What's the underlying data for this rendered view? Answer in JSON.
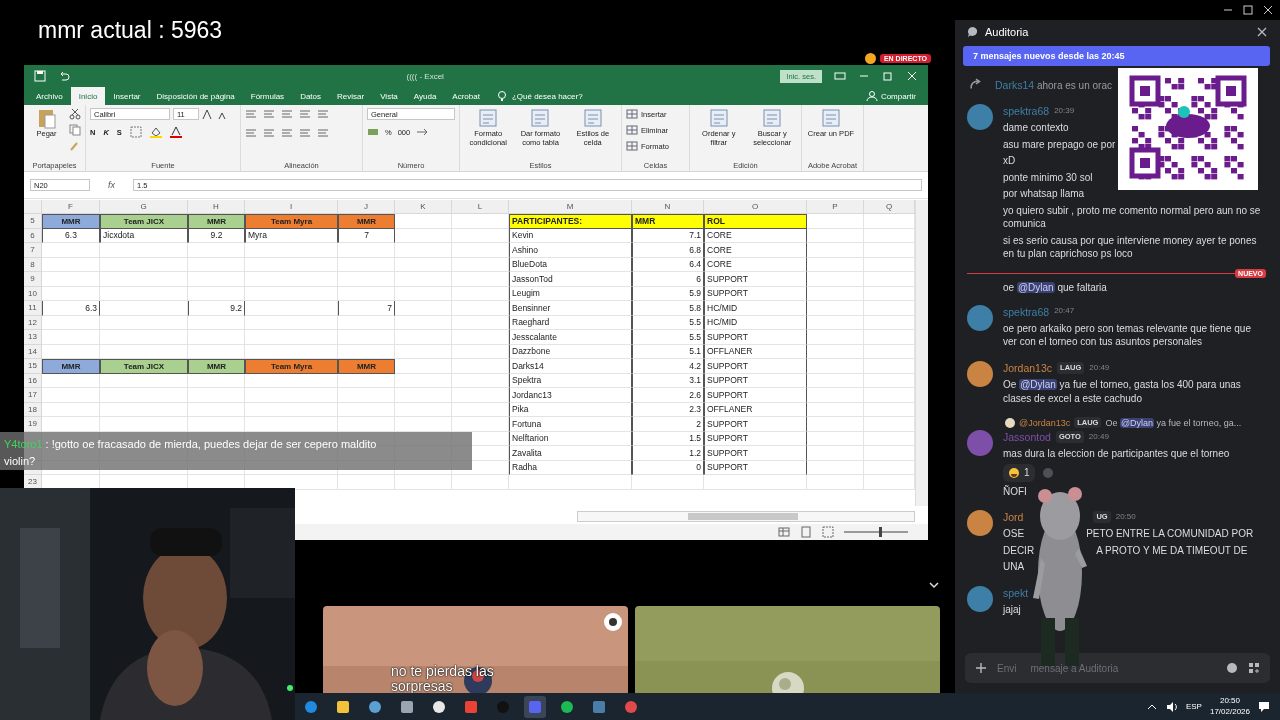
{
  "stream_title": "mmr actual : 5963",
  "live_badge": "EN DIRECTO",
  "excel": {
    "title": "(((( - Excel",
    "sign_in": "Inic. ses.",
    "tabs": [
      {
        "label": "Archivo",
        "selected": false
      },
      {
        "label": "Inicio",
        "selected": true
      },
      {
        "label": "Insertar",
        "selected": false
      },
      {
        "label": "Disposición de página",
        "selected": false
      },
      {
        "label": "Fórmulas",
        "selected": false
      },
      {
        "label": "Datos",
        "selected": false
      },
      {
        "label": "Revisar",
        "selected": false
      },
      {
        "label": "Vista",
        "selected": false
      },
      {
        "label": "Ayuda",
        "selected": false
      },
      {
        "label": "Acrobat",
        "selected": false
      }
    ],
    "tell_me": "¿Qué desea hacer?",
    "share": "Compartir",
    "ribbon": [
      {
        "kind": "clipboard",
        "label": "Portapapeles",
        "buttons": [
          "Pegar"
        ]
      },
      {
        "kind": "font",
        "label": "Fuente",
        "font": "Calibri",
        "size": "11",
        "styles": [
          "N",
          "K",
          "S"
        ]
      },
      {
        "kind": "alignment",
        "label": "Alineación"
      },
      {
        "kind": "number",
        "label": "Número",
        "format": "General",
        "symbols": [
          "%",
          "000"
        ]
      },
      {
        "kind": "big-buttons",
        "label": "Estilos",
        "buttons": [
          "Formato condicional",
          "Dar formato como tabla",
          "Estilos de celda"
        ]
      },
      {
        "kind": "small-buttons",
        "label": "Celdas",
        "buttons": [
          "Insertar",
          "Eliminar",
          "Formato"
        ]
      },
      {
        "kind": "big-buttons",
        "label": "Edición",
        "buttons": [
          "Ordenar y filtrar",
          "Buscar y seleccionar"
        ]
      },
      {
        "kind": "big-buttons",
        "label": "Adobe Acrobat",
        "buttons": [
          "Crear un PDF"
        ]
      }
    ],
    "name_box": "N20",
    "fx": "fx",
    "formula": "1.5",
    "columns": [
      "F",
      "G",
      "H",
      "I",
      "J",
      "K",
      "L",
      "M",
      "N",
      "O",
      "P",
      "Q"
    ],
    "rows": [
      {
        "number": "5",
        "cells": [
          {
            "kind": "team-header",
            "text": "MMR",
            "color": "#8eaadb"
          },
          {
            "kind": "team-header",
            "text": "Team JICX",
            "color": "#a9d08e"
          },
          {
            "kind": "team-header",
            "text": "MMR",
            "color": "#a9d08e"
          },
          {
            "kind": "team-header",
            "text": "Team Myra",
            "color": "#ed7d31"
          },
          {
            "kind": "team-header",
            "text": "MMR",
            "color": "#ed7d31"
          },
          null,
          null,
          {
            "kind": "list-header",
            "text": "PARTICIPANTES:",
            "color": "#ffff00"
          },
          {
            "kind": "list-header",
            "text": "MMR",
            "color": "#ffff00"
          },
          {
            "kind": "list-header",
            "text": "ROL",
            "color": "#ffff00"
          }
        ]
      },
      {
        "number": "6",
        "cells": [
          {
            "kind": "value",
            "text": "6.3"
          },
          {
            "kind": "label",
            "text": "Jicxdota"
          },
          {
            "kind": "value",
            "text": "9.2"
          },
          {
            "kind": "label",
            "text": "Myra"
          },
          {
            "kind": "value",
            "text": "7"
          },
          null,
          null,
          {
            "kind": "label",
            "text": "Kevin"
          },
          {
            "kind": "number",
            "text": "7.1"
          },
          {
            "kind": "label",
            "text": "CORE"
          }
        ]
      },
      {
        "number": "7",
        "cells": [
          null,
          null,
          null,
          null,
          null,
          null,
          null,
          {
            "kind": "label",
            "text": "Ashino"
          },
          {
            "kind": "number",
            "text": "6.8"
          },
          {
            "kind": "label",
            "text": "CORE"
          }
        ]
      },
      {
        "number": "8",
        "cells": [
          null,
          null,
          null,
          null,
          null,
          null,
          null,
          {
            "kind": "label",
            "text": "BlueDota"
          },
          {
            "kind": "number",
            "text": "6.4"
          },
          {
            "kind": "label",
            "text": "CORE"
          }
        ]
      },
      {
        "number": "9",
        "cells": [
          null,
          null,
          null,
          null,
          null,
          null,
          null,
          {
            "kind": "label",
            "text": "JassonTod"
          },
          {
            "kind": "number",
            "text": "6"
          },
          {
            "kind": "label",
            "text": "SUPPORT"
          }
        ]
      },
      {
        "number": "10",
        "cells": [
          null,
          null,
          null,
          null,
          null,
          null,
          null,
          {
            "kind": "label",
            "text": "Leugim"
          },
          {
            "kind": "number",
            "text": "5.9"
          },
          {
            "kind": "label",
            "text": "SUPPORT"
          }
        ]
      },
      {
        "number": "11",
        "cells": [
          {
            "kind": "number",
            "text": "6.3"
          },
          null,
          {
            "kind": "number",
            "text": "9.2"
          },
          null,
          {
            "kind": "number",
            "text": "7"
          },
          null,
          null,
          {
            "kind": "label",
            "text": "Bensinner"
          },
          {
            "kind": "number",
            "text": "5.8"
          },
          {
            "kind": "label",
            "text": "HC/MID"
          }
        ]
      },
      {
        "number": "12",
        "cells": [
          null,
          null,
          null,
          null,
          null,
          null,
          null,
          {
            "kind": "label",
            "text": "Raeghard"
          },
          {
            "kind": "number",
            "text": "5.5"
          },
          {
            "kind": "label",
            "text": "HC/MID"
          }
        ]
      },
      {
        "number": "13",
        "cells": [
          null,
          null,
          null,
          null,
          null,
          null,
          null,
          {
            "kind": "label",
            "text": "Jesscalante"
          },
          {
            "kind": "number",
            "text": "5.5"
          },
          {
            "kind": "label",
            "text": "SUPPORT"
          }
        ]
      },
      {
        "number": "14",
        "cells": [
          null,
          null,
          null,
          null,
          null,
          null,
          null,
          {
            "kind": "label",
            "text": "Dazzbone"
          },
          {
            "kind": "number",
            "text": "5.1"
          },
          {
            "kind": "label",
            "text": "OFFLANER"
          }
        ]
      },
      {
        "number": "15",
        "cells": [
          {
            "kind": "team-header",
            "text": "MMR",
            "color": "#8eaadb"
          },
          {
            "kind": "team-header",
            "text": "Team JICX",
            "color": "#a9d08e"
          },
          {
            "kind": "team-header",
            "text": "MMR",
            "color": "#a9d08e"
          },
          {
            "kind": "team-header",
            "text": "Team Myra",
            "color": "#ed7d31"
          },
          {
            "kind": "team-header",
            "text": "MMR",
            "color": "#ed7d31"
          },
          null,
          null,
          {
            "kind": "label",
            "text": "Darks14"
          },
          {
            "kind": "number",
            "text": "4.2"
          },
          {
            "kind": "label",
            "text": "SUPPORT"
          }
        ]
      },
      {
        "number": "16",
        "cells": [
          null,
          null,
          null,
          null,
          null,
          null,
          null,
          {
            "kind": "label",
            "text": "Spektra"
          },
          {
            "kind": "number",
            "text": "3.1"
          },
          {
            "kind": "label",
            "text": "SUPPORT"
          }
        ]
      },
      {
        "number": "17",
        "cells": [
          null,
          null,
          null,
          null,
          null,
          null,
          null,
          {
            "kind": "label",
            "text": "Jordanc13"
          },
          {
            "kind": "number",
            "text": "2.6"
          },
          {
            "kind": "label",
            "text": "SUPPORT"
          }
        ]
      },
      {
        "number": "18",
        "cells": [
          null,
          null,
          null,
          null,
          null,
          null,
          null,
          {
            "kind": "label",
            "text": "Pika"
          },
          {
            "kind": "number",
            "text": "2.3"
          },
          {
            "kind": "label",
            "text": "OFFLANER"
          }
        ]
      },
      {
        "number": "19",
        "cells": [
          null,
          null,
          null,
          null,
          null,
          null,
          null,
          {
            "kind": "label",
            "text": "Fortuna"
          },
          {
            "kind": "number",
            "text": "2"
          },
          {
            "kind": "label",
            "text": "SUPPORT"
          }
        ]
      },
      {
        "cells": [
          null,
          null,
          null,
          null,
          null,
          null,
          null,
          {
            "kind": "label",
            "text": "Nelftarion"
          },
          {
            "kind": "number",
            "text": "1.5"
          },
          {
            "kind": "label",
            "text": "SUPPORT"
          }
        ]
      },
      {
        "cells": [
          null,
          null,
          null,
          null,
          null,
          null,
          null,
          {
            "kind": "label",
            "text": "Zavalita"
          },
          {
            "kind": "number",
            "text": "1.2"
          },
          {
            "kind": "label",
            "text": "SUPPORT"
          }
        ]
      },
      {
        "cells": [
          null,
          null,
          null,
          null,
          null,
          null,
          null,
          {
            "kind": "label",
            "text": "Radha"
          },
          {
            "kind": "number",
            "text": "0"
          },
          {
            "kind": "label",
            "text": "SUPPORT"
          }
        ]
      },
      {
        "number": "23",
        "cells": []
      }
    ],
    "zoom": {
      "level": 0.55
    }
  },
  "chat_overlay": {
    "user": "Y4toro1",
    "message": " : !gotto oe fracasado de mierda, puedes dejar de ser cepero maldito",
    "continuation": "violin?"
  },
  "video_tiles": {
    "caption": "no te pierdas las sorpresas"
  },
  "taskbar": {
    "language": "ESP",
    "time": "20:50",
    "date": "17/02/2026"
  },
  "discord": {
    "channel": "Auditoria",
    "new_messages": "7 mensajes nuevos desde las 20:45",
    "messages": [
      {
        "kind": "system",
        "author": "Darks14",
        "text": "ahora es un orac"
      },
      {
        "kind": "group",
        "author": "spektra68",
        "color": "#3d7fa6",
        "time": "20:39",
        "lines": [
          "dame contexto",
          "asu mare prepago oe por",
          "xD",
          "ponte minimo 30 sol",
          "por whatsap llama",
          "yo quiero subir , proto me comento normal pero aun no se comunica",
          "si es serio causa por que interviene money ayer te pones en tu plan caprichoso ps loco"
        ]
      },
      {
        "kind": "divider",
        "text": "NUEVO"
      },
      {
        "kind": "mention-line",
        "before": "oe ",
        "mention": "@Dylan",
        "after": " que faltaria"
      },
      {
        "kind": "group",
        "author": "spektra68",
        "color": "#3d7fa6",
        "time": "20:47",
        "lines": [
          "oe pero arkaiko pero son temas relevante que tiene que ver con el torneo con tus asuntos personales"
        ]
      },
      {
        "kind": "mention-group",
        "author": "Jordan13c",
        "color": "#c98443",
        "badge": "LAUG",
        "time": "20:49",
        "before": "Oe ",
        "mention": "@Dylan",
        "after": " ya fue el torneo, gasta los 400 para unas clases de excel a este cachudo"
      },
      {
        "kind": "reply",
        "reply_author": "@Jordan13c",
        "reply_badge": "LAUG",
        "reply_before": "Oe ",
        "reply_mention": "@Dylan",
        "reply_after": " ya fue el torneo, ga...",
        "author": "Jassontod",
        "color": "#7d4fa8",
        "badge": "GOTO",
        "time": "20:49",
        "text": "mas dura la eleccion de participantes que el torneo",
        "reaction": "1",
        "extra": "ÑOFI"
      },
      {
        "kind": "split-group",
        "author": "Jord",
        "color": "#c98443",
        "badge": "UG",
        "time": "20:50",
        "lines": [
          [
            "OSE",
            "PETO ENTRE LA COMUNIDAD POR"
          ],
          [
            "DECIR",
            "A PROTO Y ME DA TIMEOUT DE"
          ],
          [
            "UNA"
          ]
        ]
      },
      {
        "kind": "split-group",
        "author": "spekt",
        "color": "#3d7fa6",
        "lines": [
          [
            "jajaj"
          ]
        ]
      }
    ],
    "placeholder_parts": [
      "Envi",
      "mensaje a Auditoria"
    ]
  }
}
